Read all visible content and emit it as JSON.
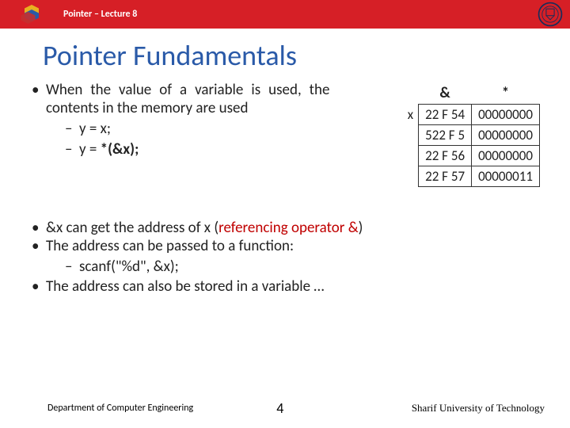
{
  "header": {
    "breadcrumb": "Pointer – Lecture 8"
  },
  "title": "Pointer Fundamentals",
  "bullet1": "When the value of a variable is used, the contents in the memory are used",
  "sub1a": "y = x;",
  "sub1b_pre": "y = ",
  "sub1b_bold": "*(&x);",
  "table": {
    "h1": "&",
    "h2": "*",
    "rowlabel": "x",
    "rows": [
      {
        "addr": "22 F 54",
        "val": "00000000"
      },
      {
        "addr": "522 F 5",
        "val": "00000000"
      },
      {
        "addr": "22 F 56",
        "val": "00000000"
      },
      {
        "addr": "22 F 57",
        "val": "00000011"
      }
    ]
  },
  "bullet2_pre": "&x can get the address of x (",
  "bullet2_red": "referencing operator &",
  "bullet2_post": ")",
  "bullet3": "The address can be passed to a function:",
  "sub3a": "scanf(\"%d\", &x);",
  "bullet4": "The address can also be stored in a variable …",
  "footer": {
    "dept": "Department of Computer Engineering",
    "page": "4",
    "uni": "Sharif University of Technology"
  }
}
